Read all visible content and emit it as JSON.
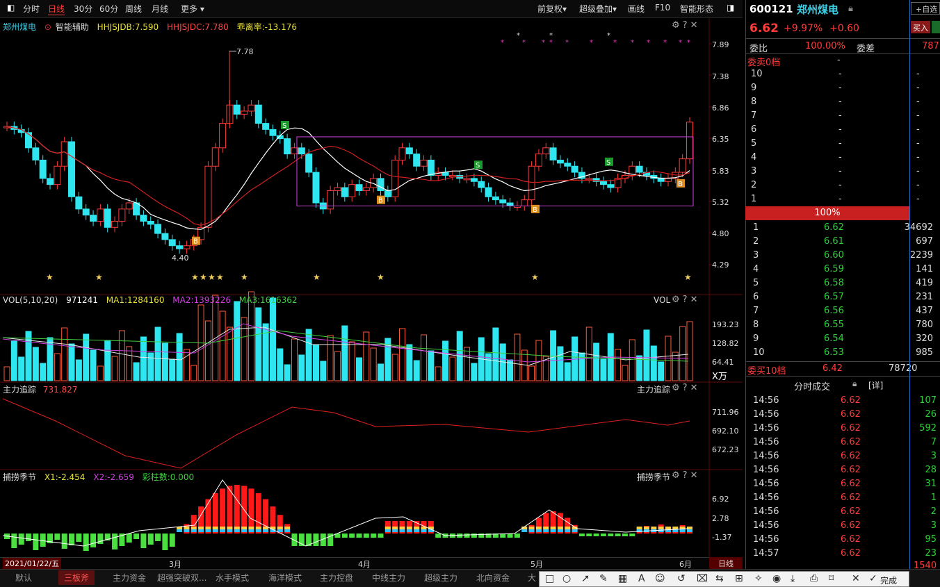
{
  "topbar": {
    "fenshi": "分时",
    "rixian": "日线",
    "m30": "30分",
    "m60": "60分",
    "week": "周线",
    "month": "月线",
    "more": "更多",
    "fuquan": "前复权",
    "overlay": "超级叠加",
    "draw": "画线",
    "f10": "F10",
    "smart": "智能形态"
  },
  "main_panel": {
    "stock_name": "郑州煤电",
    "assist": "智能辅助",
    "hhjsjdb": "HHJSJDB:7.590",
    "hhjsjdc": "HHJSJDC:7.780",
    "deviation": "乖离率:-13.176",
    "y_labels": [
      "7.89",
      "7.38",
      "6.86",
      "6.35",
      "5.83",
      "5.32",
      "4.80",
      "4.29"
    ],
    "high_label": "7.78",
    "low_label": "4.40",
    "signal_s": "S",
    "signal_b": "B"
  },
  "vol_panel": {
    "title": "VOL(5,10,20)",
    "value": "971241",
    "ma1": "MA1:1284160",
    "ma2": "MA2:1393226",
    "ma3": "MA3:1616362",
    "name": "VOL",
    "y_labels": [
      "193.23",
      "128.82",
      "64.41"
    ],
    "unit": "X万"
  },
  "zhuli_panel": {
    "title": "主力追踪",
    "value": "731.827",
    "name": "主力追踪",
    "y_labels": [
      "711.96",
      "692.10",
      "672.23"
    ]
  },
  "bulao_panel": {
    "title": "捕捞季节",
    "x1": "X1:-2.454",
    "x2": "X2:-2.659",
    "caizhu": "彩柱数:0.000",
    "name": "捕捞季节",
    "y_labels": [
      "6.92",
      "2.78",
      "-1.37"
    ]
  },
  "x_axis": {
    "date": "2021/01/22/五",
    "m3": "3月",
    "m4": "4月",
    "m5": "5月",
    "m6": "6月",
    "mode": "日线"
  },
  "quote": {
    "code": "600121",
    "name": "郑州煤电",
    "price": "6.62",
    "pct": "+9.97%",
    "change": "+0.60",
    "self_select": "+自选",
    "buy_btn": "买入",
    "weibi_label": "委比",
    "weibi": "100.00%",
    "weicha_label": "委差",
    "weicha": "787",
    "sell_title": "委卖0档",
    "sell_title_val": "-",
    "sell_levels": [
      {
        "n": "10",
        "p": "-",
        "v": "-"
      },
      {
        "n": "9",
        "p": "-",
        "v": "-"
      },
      {
        "n": "8",
        "p": "-",
        "v": "-"
      },
      {
        "n": "7",
        "p": "-",
        "v": "-"
      },
      {
        "n": "6",
        "p": "-",
        "v": "-"
      },
      {
        "n": "5",
        "p": "-",
        "v": "-"
      },
      {
        "n": "4",
        "p": "-",
        "v": "-"
      },
      {
        "n": "3",
        "p": "-",
        "v": "-"
      },
      {
        "n": "2",
        "p": "-",
        "v": "-"
      },
      {
        "n": "1",
        "p": "-",
        "v": "-"
      }
    ],
    "ratio_bar": "100%",
    "buy_levels": [
      {
        "n": "1",
        "p": "6.62",
        "v": "34692"
      },
      {
        "n": "2",
        "p": "6.61",
        "v": "697"
      },
      {
        "n": "3",
        "p": "6.60",
        "v": "2239"
      },
      {
        "n": "4",
        "p": "6.59",
        "v": "141"
      },
      {
        "n": "5",
        "p": "6.58",
        "v": "419"
      },
      {
        "n": "6",
        "p": "6.57",
        "v": "231"
      },
      {
        "n": "7",
        "p": "6.56",
        "v": "437"
      },
      {
        "n": "8",
        "p": "6.55",
        "v": "780"
      },
      {
        "n": "9",
        "p": "6.54",
        "v": "320"
      },
      {
        "n": "10",
        "p": "6.53",
        "v": "985"
      }
    ],
    "buy_title": "委买10档",
    "buy_title_price": "6.42",
    "buy_title_vol": "78720",
    "ticks_title": "分时成交",
    "ticks_detail": "[详]",
    "ticks": [
      {
        "t": "14:56",
        "p": "6.62",
        "v": "107"
      },
      {
        "t": "14:56",
        "p": "6.62",
        "v": "26"
      },
      {
        "t": "14:56",
        "p": "6.62",
        "v": "592"
      },
      {
        "t": "14:56",
        "p": "6.62",
        "v": "7"
      },
      {
        "t": "14:56",
        "p": "6.62",
        "v": "3"
      },
      {
        "t": "14:56",
        "p": "6.62",
        "v": "28"
      },
      {
        "t": "14:56",
        "p": "6.62",
        "v": "31"
      },
      {
        "t": "14:56",
        "p": "6.62",
        "v": "1"
      },
      {
        "t": "14:56",
        "p": "6.62",
        "v": "2"
      },
      {
        "t": "14:56",
        "p": "6.62",
        "v": "3"
      },
      {
        "t": "14:56",
        "p": "6.62",
        "v": "95"
      },
      {
        "t": "14:57",
        "p": "6.62",
        "v": "23"
      }
    ]
  },
  "bottom": {
    "tabs": [
      "默认",
      "三板斧",
      "主力资金",
      "超强突破双...",
      "水手模式",
      "海洋模式",
      "主力控盘",
      "中线主力",
      "超级主力",
      "北向资金",
      "大"
    ],
    "last_val": "1540",
    "done": "完成"
  }
}
